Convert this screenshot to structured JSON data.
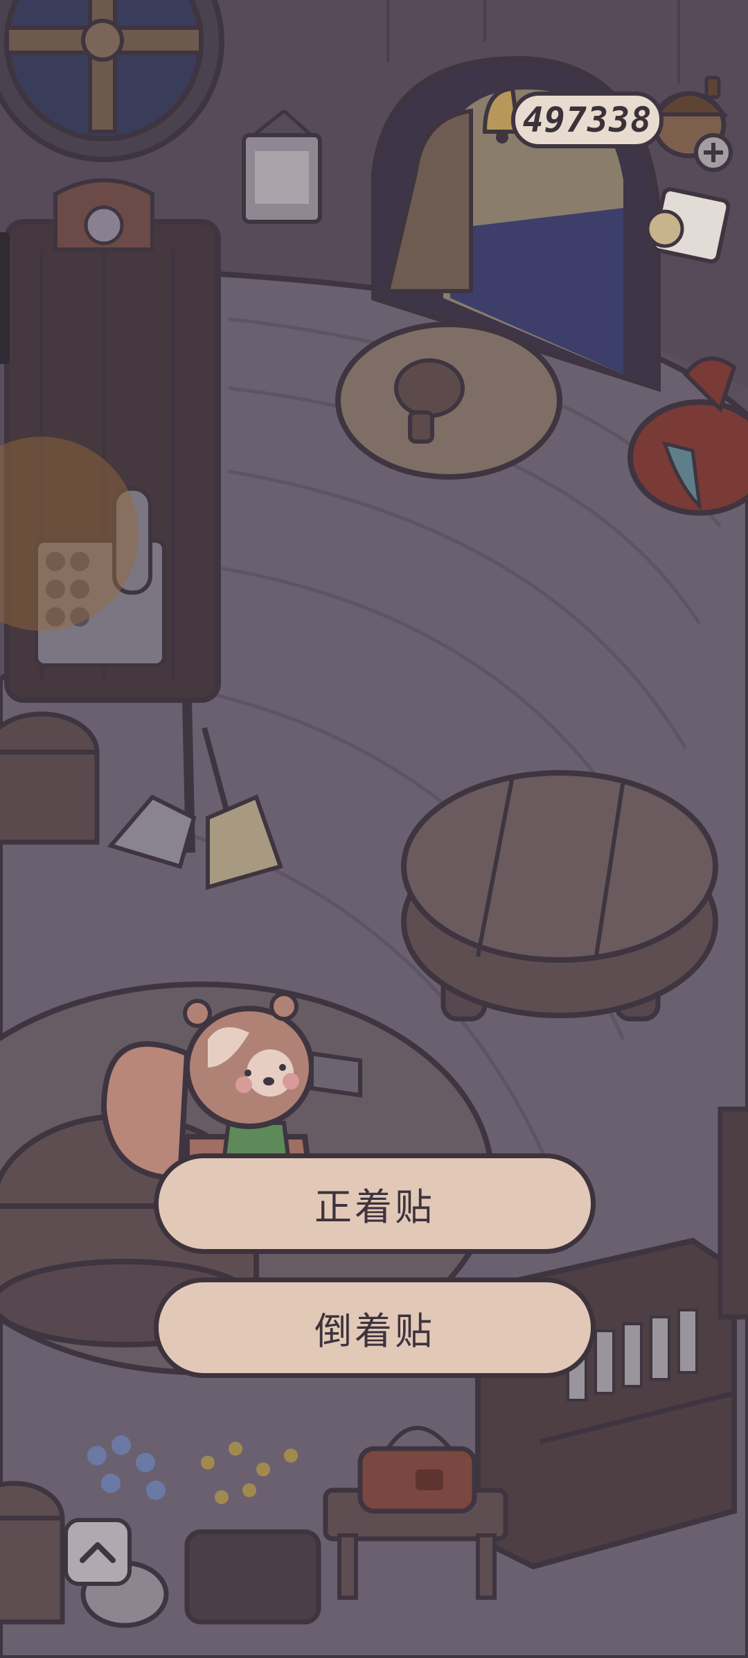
{
  "hud": {
    "coin_count": "497338",
    "icons": [
      "bell-icon",
      "acorn-icon",
      "plus-icon",
      "note-card-icon",
      "gift-bag-icon"
    ]
  },
  "options": {
    "upright_label": "正着贴",
    "inverted_label": "倒着贴"
  },
  "bottom": {
    "expand_icon": "chevron-up-icon"
  },
  "colors": {
    "button_fill": "#e2c9b7",
    "button_border": "#3d333d",
    "dim_overlay": "#5e5260"
  }
}
